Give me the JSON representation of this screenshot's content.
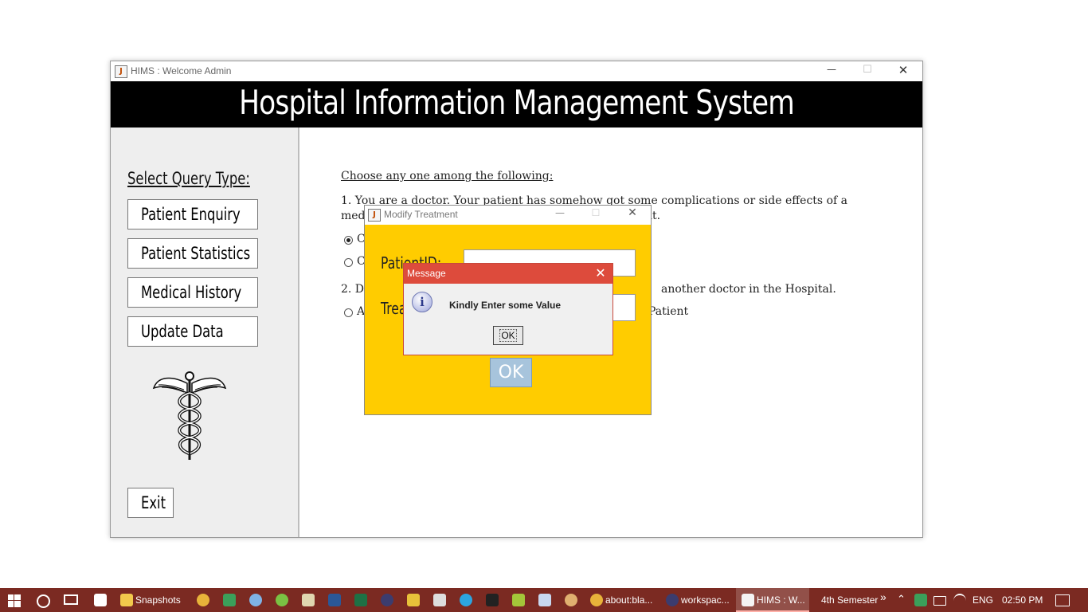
{
  "main_window": {
    "title": "HIMS : Welcome Admin",
    "banner_title": "Hospital Information Management System",
    "controls": {
      "minimize": "—",
      "maximize": "☐",
      "close": "✕"
    }
  },
  "sidebar": {
    "label": "Select Query Type:",
    "buttons": [
      "Patient Enquiry",
      "Patient Statistics",
      "Medical History",
      "Update Data"
    ],
    "exit_label": "Exit"
  },
  "content": {
    "heading": "Choose any one among the following:",
    "q1_line1": "1. You are a doctor. Your patient has somehow got some complications or side effects of a",
    "q1_line2_start": "med",
    "q1_line2_end": "nt.",
    "opt1_start": "C",
    "opt2_start": "C",
    "q2_start": "2. Du",
    "q2_end": "another doctor in the Hospital.",
    "opt3_start": "A",
    "opt3_end": "Patient"
  },
  "modify_dialog": {
    "title": "Modify Treatment",
    "patient_id_label": "PatientID:",
    "treatment_label": "Treatment:",
    "ok_label": "OK"
  },
  "message_dialog": {
    "title": "Message",
    "text": "Kindly Enter some Value",
    "ok_label": "OK",
    "icon_glyph": "i",
    "close_glyph": "✕"
  },
  "taskbar": {
    "items": [
      "Snapshots",
      "about:bla...",
      "workspac...",
      "HIMS : W..."
    ],
    "folder_label": "4th Semester",
    "language": "ENG",
    "time": "02:50 PM"
  }
}
